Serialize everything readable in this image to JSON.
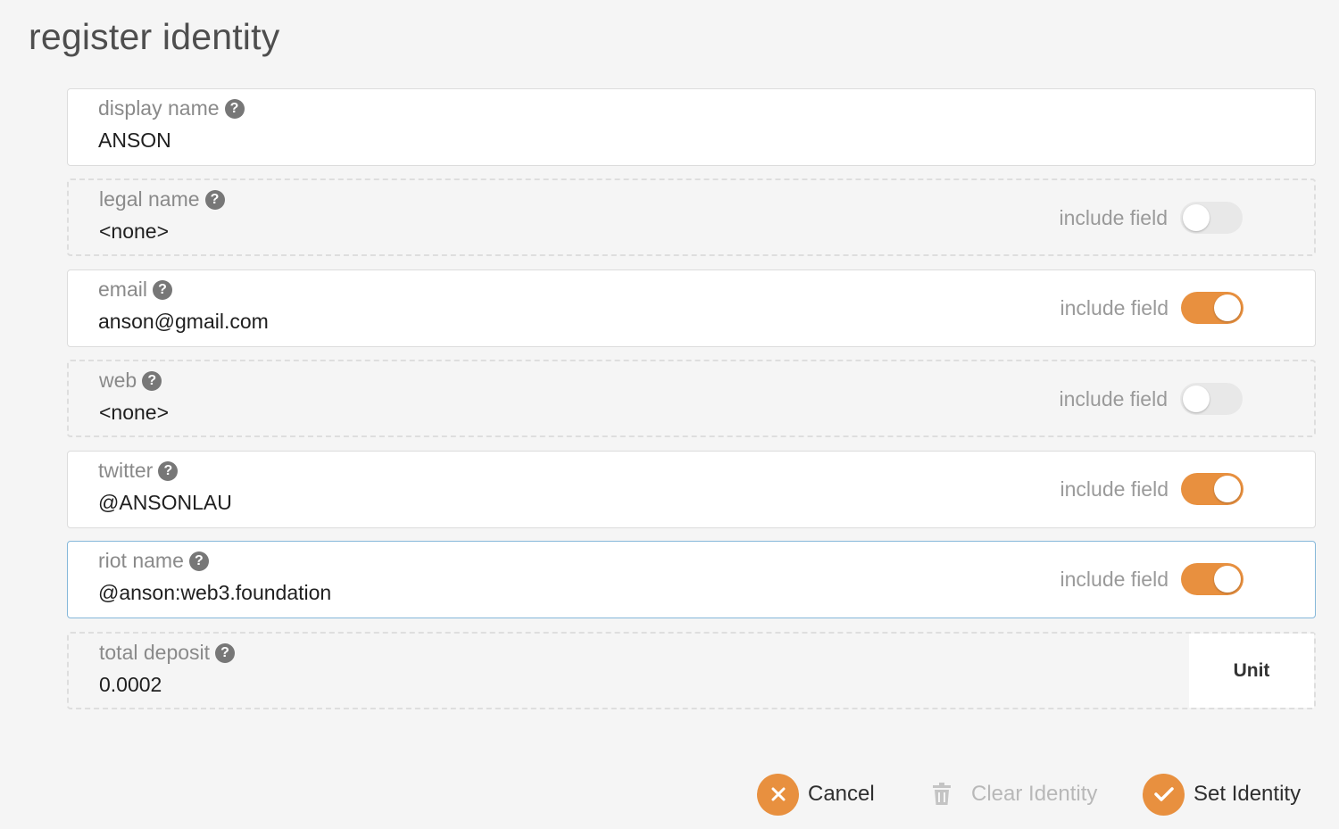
{
  "page": {
    "title": "register identity"
  },
  "fields": [
    {
      "label": "display name",
      "value": "ANSON"
    },
    {
      "label": "legal name",
      "value": "<none>",
      "include_label": "include field",
      "included": false
    },
    {
      "label": "email",
      "value": "anson@gmail.com",
      "include_label": "include field",
      "included": true
    },
    {
      "label": "web",
      "value": "<none>",
      "include_label": "include field",
      "included": false
    },
    {
      "label": "twitter",
      "value": "@ANSONLAU",
      "include_label": "include field",
      "included": true
    },
    {
      "label": "riot name",
      "value": "@anson:web3.foundation",
      "include_label": "include field",
      "included": true
    }
  ],
  "deposit": {
    "label": "total deposit",
    "value": "0.0002",
    "unit": "Unit"
  },
  "actions": {
    "cancel": "Cancel",
    "clear": "Clear Identity",
    "set": "Set Identity"
  },
  "colors": {
    "accent": "#e8903f",
    "focus_border": "#85b7d9"
  },
  "icons": {
    "help": "question-circle-icon",
    "cancel": "x-circle-icon",
    "clear": "trash-icon",
    "set": "check-circle-icon"
  }
}
